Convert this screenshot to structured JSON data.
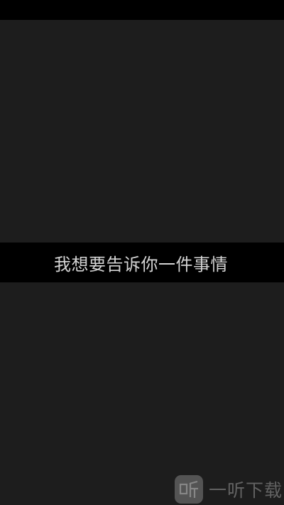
{
  "caption": {
    "text": "我想要告诉你一件事情"
  },
  "watermark": {
    "text": "一听下载",
    "logo_char": "听"
  },
  "colors": {
    "background": "#000000",
    "panel": "#1d1d1d",
    "caption_text": "#d4d4d4",
    "watermark": "#6f6f6f"
  }
}
